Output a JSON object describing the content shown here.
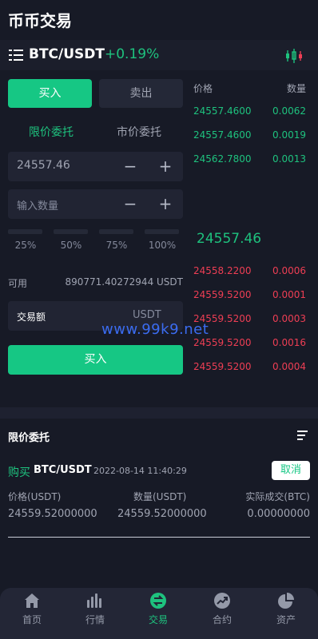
{
  "header": {
    "title": "币币交易"
  },
  "pair_bar": {
    "pair": "BTC/USDT",
    "change": "+0.19%"
  },
  "trade": {
    "buy_tab": "买入",
    "sell_tab": "卖出",
    "limit_order": "限价委托",
    "market_order": "市价委托",
    "price_value": "24557.46",
    "qty_placeholder": "输入数量",
    "percent_options": [
      "25%",
      "50%",
      "75%",
      "100%"
    ],
    "available_label": "可用",
    "available_value": "890771.40272944 USDT",
    "amount_label": "交易额",
    "amount_unit": "USDT",
    "submit_label": "买入"
  },
  "order_book": {
    "price_header": "价格",
    "qty_header": "数量",
    "bids": [
      {
        "price": "24557.4600",
        "qty": "0.0062"
      },
      {
        "price": "24557.4600",
        "qty": "0.0019"
      },
      {
        "price": "24562.7800",
        "qty": "0.0013"
      }
    ],
    "mid_price": "24557.46",
    "asks": [
      {
        "price": "24558.2200",
        "qty": "0.0006"
      },
      {
        "price": "24559.5200",
        "qty": "0.0001"
      },
      {
        "price": "24559.5200",
        "qty": "0.0003"
      },
      {
        "price": "24559.5200",
        "qty": "0.0016"
      },
      {
        "price": "24559.5200",
        "qty": "0.0004"
      }
    ]
  },
  "watermark": "www.99k9.net",
  "orders": {
    "title": "限价委托",
    "items": [
      {
        "side": "购买",
        "pair": "BTC/USDT",
        "time": "2022-08-14 11:40:29",
        "cancel": "取消",
        "price_label": "价格(USDT)",
        "qty_label": "数量(USDT)",
        "filled_label": "实际成交(BTC)",
        "price": "24559.52000000",
        "qty": "24559.52000000",
        "filled": "0.00000000"
      }
    ]
  },
  "nav": {
    "items": [
      {
        "label": "首页",
        "icon": "home-icon"
      },
      {
        "label": "行情",
        "icon": "market-chart-icon"
      },
      {
        "label": "交易",
        "icon": "trade-icon"
      },
      {
        "label": "合约",
        "icon": "contract-trend-icon"
      },
      {
        "label": "资产",
        "icon": "assets-pie-icon"
      }
    ],
    "active": "交易"
  },
  "colors": {
    "green": "#1ec27e",
    "red": "#ee3e54",
    "background": "#171a26"
  }
}
